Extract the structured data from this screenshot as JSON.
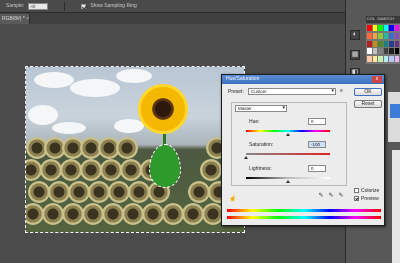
{
  "options": {
    "sample_label": "Sample:",
    "sample_value": "All Layers",
    "show_ring_label": "Show Sampling Ring"
  },
  "document": {
    "tab_label": "RGB/8#) *",
    "close_glyph": "×"
  },
  "panel": {
    "tabs": [
      "COL",
      "SWATCH"
    ]
  },
  "dialog": {
    "title": "Hue/Saturation",
    "close_glyph": "x",
    "preset_label": "Preset:",
    "preset_value": "Custom",
    "preset_menu_glyph": "≡",
    "channel_value": "Master",
    "ok_label": "OK",
    "cancel_label": "Reset",
    "hue_label": "Hue:",
    "hue_value": "0",
    "saturation_label": "Saturation:",
    "saturation_value": "-100",
    "lightness_label": "Lightness:",
    "lightness_value": "0",
    "colorize_label": "Colorize",
    "colorize_checked": false,
    "preview_label": "Preview",
    "preview_checked": true
  },
  "sliders": {
    "hue_position": 0.5,
    "saturation_position": 0.0,
    "lightness_position": 0.5
  }
}
